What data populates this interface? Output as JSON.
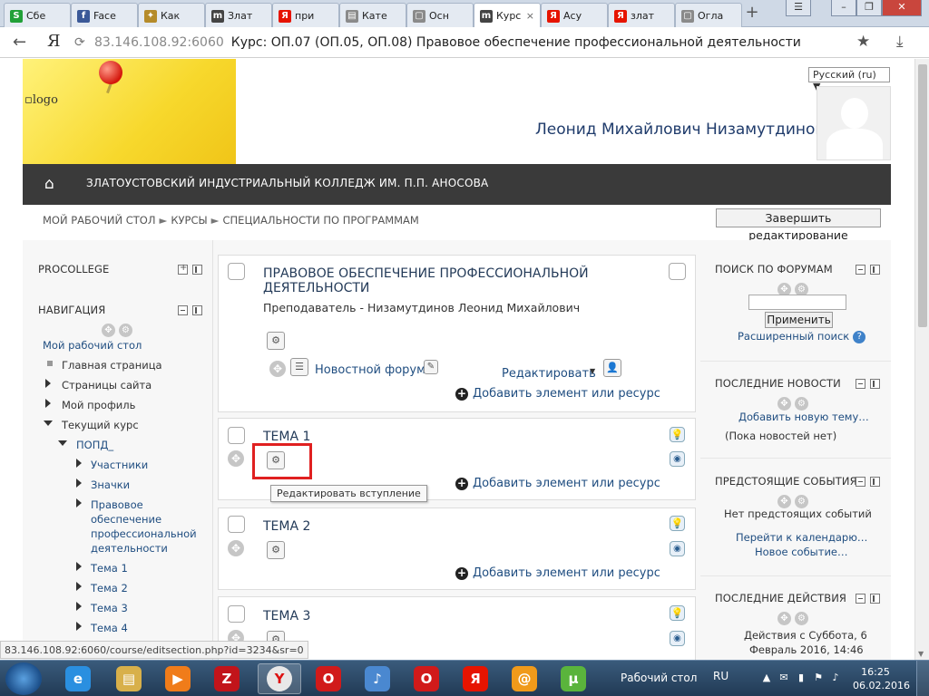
{
  "browser": {
    "tabs": [
      {
        "title": "Сбе",
        "fav": "sberbank-icon",
        "color": "#21a038",
        "glyph": "S"
      },
      {
        "title": "Face",
        "fav": "facebook-icon",
        "color": "#3b5998",
        "glyph": "f"
      },
      {
        "title": "Как",
        "fav": "bookmark-icon",
        "color": "#b58b2a",
        "glyph": "✦"
      },
      {
        "title": "Злат",
        "fav": "moodle-icon",
        "color": "#444444",
        "glyph": "m"
      },
      {
        "title": "при",
        "fav": "yandex-icon",
        "color": "#e61400",
        "glyph": "Я"
      },
      {
        "title": "Кате",
        "fav": "page-icon",
        "color": "#8a8a8a",
        "glyph": "▤"
      },
      {
        "title": "Осн",
        "fav": "page-icon",
        "color": "#8a8a8a",
        "glyph": "▢"
      },
      {
        "title": "Курс",
        "fav": "moodle-icon",
        "color": "#444444",
        "glyph": "m",
        "active": true
      },
      {
        "title": "Асу",
        "fav": "yandex-icon",
        "color": "#e61400",
        "glyph": "Я"
      },
      {
        "title": "злат",
        "fav": "yandex-icon",
        "color": "#e61400",
        "glyph": "Я"
      },
      {
        "title": "Огла",
        "fav": "page-icon",
        "color": "#8a8a8a",
        "glyph": "▢"
      }
    ],
    "address_host": "83.146.108.92:6060",
    "address_title": "Курс: ОП.07 (ОП.05, ОП.08) Правовое обеспечение профессиональной деятельности",
    "yandex_button": "Я"
  },
  "page": {
    "language": "Русский (ru) ▼",
    "logo_alt": "logo",
    "user_name": "Леонид Михайлович Низамутдинов ▼",
    "college": "ЗЛАТОУСТОВСКИЙ ИНДУСТРИАЛЬНЫЙ КОЛЛЕДЖ ИМ. П.П. АНОСОВА",
    "breadcrumb": [
      "МОЙ РАБОЧИЙ СТОЛ",
      "КУРСЫ",
      "СПЕЦИАЛЬНОСТИ ПО ПРОГРАММАМ"
    ],
    "breadcrumb_sep": "►",
    "finish_editing": "Завершить редактирование"
  },
  "left": {
    "procollege": "PROCOLLEGE",
    "navigation": "НАВИГАЦИЯ",
    "my_desk": "Мой рабочий стол",
    "items": [
      "Главная страница",
      "Страницы сайта",
      "Мой профиль",
      "Текущий курс"
    ],
    "course_short": "ПОПД_",
    "course_items": [
      "Участники",
      "Значки"
    ],
    "course_topic_lines": [
      "Правовое",
      "обеспечение",
      "профессиональной",
      "деятельности"
    ],
    "themes": [
      "Тема 1",
      "Тема 2",
      "Тема 3",
      "Тема 4"
    ]
  },
  "center": {
    "course_title_line1": "ПРАВОВОЕ ОБЕСПЕЧЕНИЕ ПРОФЕССИОНАЛЬНОЙ",
    "course_title_line2": "ДЕЯТЕЛЬНОСТИ",
    "teacher": "Преподаватель - Низамутдинов Леонид Михайлович",
    "news_forum": "Новостной форум",
    "edit_menu": "Редактировать",
    "add_resource": "Добавить элемент или ресурс",
    "sections": [
      "ТЕМА 1",
      "ТЕМА 2",
      "ТЕМА 3"
    ],
    "tooltip": "Редактировать вступление"
  },
  "right": {
    "forum_search": "ПОИСК ПО ФОРУМАМ",
    "apply": "Применить",
    "advanced_search": "Расширенный поиск",
    "latest_news": "ПОСЛЕДНИЕ НОВОСТИ",
    "add_topic": "Добавить новую тему…",
    "no_news": "(Пока новостей нет)",
    "upcoming": "ПРЕДСТОЯЩИЕ СОБЫТИЯ",
    "no_events": "Нет предстоящих событий",
    "go_calendar": "Перейти к календарю…",
    "new_event": "Новое событие…",
    "recent": "ПОСЛЕДНИЕ ДЕЙСТВИЯ",
    "recent_since": "Действия с Суббота, 6",
    "recent_date": "Февраль 2016, 14:46"
  },
  "statusbar": "83.146.108.92:6060/course/editsection.php?id=3234&sr=0",
  "taskbar": {
    "desktop_label": "Рабочий стол",
    "language": "RU",
    "time": "16:25",
    "date": "06.02.2016",
    "icons": [
      "ie-icon",
      "explorer-icon",
      "media-player-icon",
      "zynga-icon",
      "yandex-browser-icon",
      "opera-icon",
      "audio-icon",
      "opera-icon",
      "yandex-icon",
      "mail-icon",
      "utorrent-icon"
    ]
  }
}
